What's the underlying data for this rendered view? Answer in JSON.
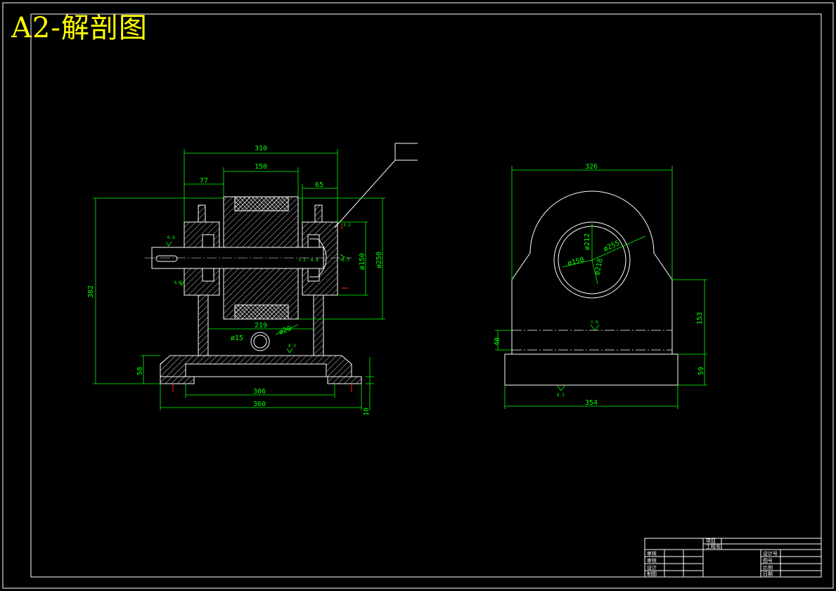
{
  "title": "A2-解剖图",
  "colors": {
    "background": "#000000",
    "outline": "#ffffff",
    "dimension": "#00ff00",
    "title": "#ffff00",
    "marker": "#ff2020"
  },
  "section_view": {
    "dims": [
      "310",
      "150",
      "77",
      "65",
      "382",
      "ø150",
      "ø250",
      "219",
      "ø20",
      "ø15",
      "58",
      "306",
      "360",
      "10"
    ],
    "small_labels": [
      "0.8",
      "0.8",
      "6.3",
      "3.2",
      "6.3",
      "6.3",
      "3.2"
    ]
  },
  "side_view": {
    "dims": [
      "326",
      "ø212",
      "ø255",
      "ø150",
      "ø218",
      "153",
      "40",
      "59",
      "354"
    ],
    "small_labels": [
      "1.6",
      "6.3"
    ]
  },
  "title_block": {
    "top_left": "项目",
    "sub_left": "工程名",
    "rows_left": [
      "审核",
      "审核",
      "设计",
      "制图"
    ],
    "rows_right": [
      "设计号",
      "图号",
      "比例",
      "日期"
    ]
  }
}
